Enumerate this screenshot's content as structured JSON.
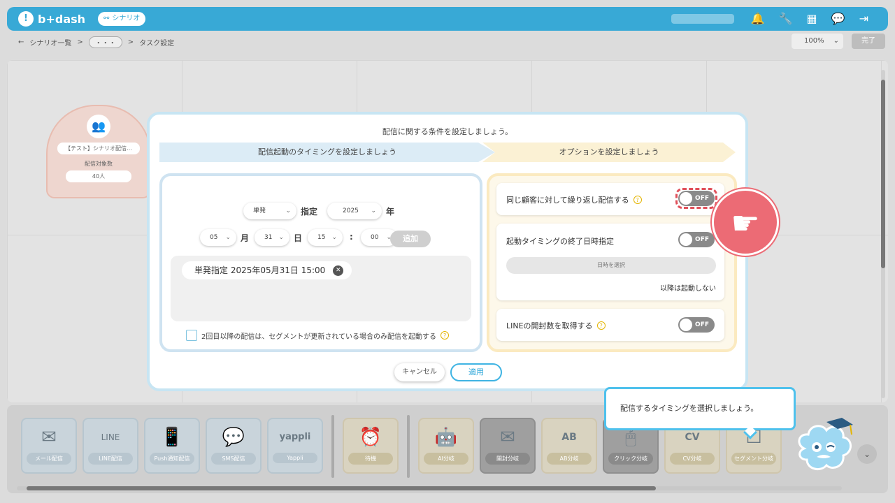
{
  "app": {
    "logo_text": "b+dash",
    "scenario_badge": "シナリオ"
  },
  "breadcrumb": {
    "back": "←",
    "item1": "シナリオ一覧",
    "sep": ">",
    "dots": "・・・",
    "item2": "タスク設定"
  },
  "toolbar": {
    "zoom": "100%",
    "done_label": "完了"
  },
  "node": {
    "title": "【テスト】シナリオ配信…",
    "sub_label": "配信対象数",
    "count": "40人"
  },
  "modal": {
    "heading": "配信に関する条件を設定しましょう。",
    "step1": "配信起動のタイミングを設定しましょう",
    "step2": "オプションを設定しましょう",
    "type_select": "単発",
    "specify_label": "指定",
    "year_select": "2025",
    "year_label": "年",
    "month_select": "05",
    "month_label": "月",
    "day_select": "31",
    "day_label": "日",
    "hour_select": "15",
    "colon": ":",
    "minute_select": "00",
    "add_label": "追加",
    "chip_text": "単発指定 2025年05月31日 15:00",
    "checkbox_label": "2回目以降の配信は、セグメントが更新されている場合のみ配信を起動する",
    "options": {
      "repeat_label": "同じ顧客に対して繰り返し配信する",
      "repeat_toggle": "OFF",
      "end_label": "起動タイミングの終了日時指定",
      "end_toggle": "OFF",
      "date_placeholder": "日時を選択",
      "after_label": "以降は起動しない",
      "line_label": "LINEの開封数を取得する",
      "line_toggle": "OFF"
    },
    "cancel_label": "キャンセル",
    "apply_label": "適用"
  },
  "tooltip": {
    "text": "配信するタイミングを選択しましょう。"
  },
  "palette": {
    "tiles": [
      {
        "label": "メール配信",
        "icon": "✉"
      },
      {
        "label": "LINE配信",
        "icon": "LINE"
      },
      {
        "label": "Push通知配信",
        "icon": "📱"
      },
      {
        "label": "SMS配信",
        "icon": "💬"
      },
      {
        "label": "Yappli",
        "icon": "yappli"
      },
      {
        "label": "待機",
        "icon": "⏰"
      },
      {
        "label": "AI分岐",
        "icon": "🤖"
      },
      {
        "label": "開封分岐",
        "icon": "✉"
      },
      {
        "label": "AB分岐",
        "icon": "AB"
      },
      {
        "label": "クリック分岐",
        "icon": "🖱"
      },
      {
        "label": "CV分岐",
        "icon": "CV"
      },
      {
        "label": "セグメント分岐",
        "icon": "☐"
      }
    ]
  },
  "colors": {
    "brand": "#38a9d6",
    "pointer": "#ec6b75",
    "highlight": "#e0505a"
  }
}
